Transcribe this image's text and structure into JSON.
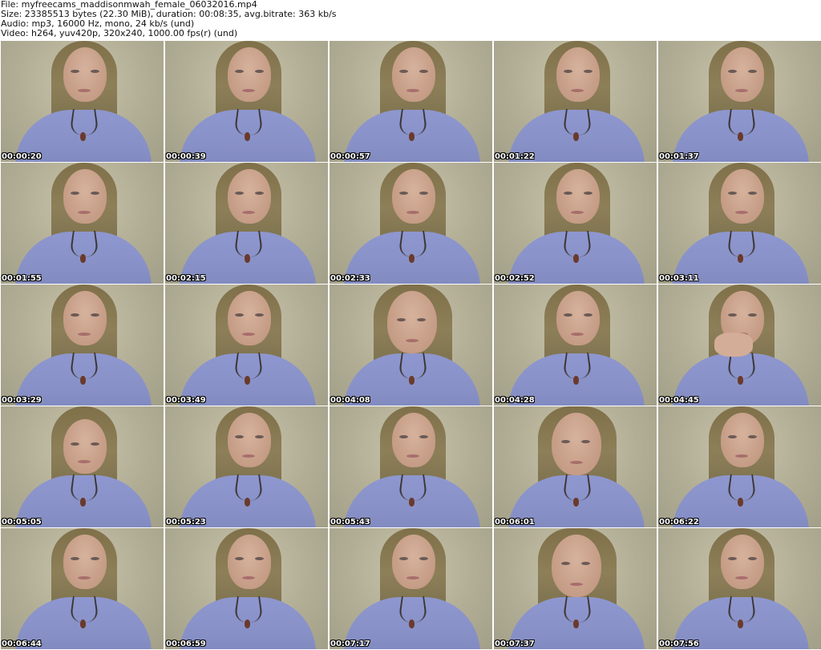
{
  "header": {
    "file_line": "File: myfreecams_maddisonmwah_female_06032016.mp4",
    "size_line": "Size: 23385513 bytes (22.30 MiB), duration: 00:08:35, avg.bitrate: 363 kb/s",
    "audio_line": "Audio: mp3, 16000 Hz, mono, 24 kb/s (und)",
    "video_line": "Video: h264, yuv420p, 320x240, 1000.00 fps(r) (und)"
  },
  "thumbnails": [
    {
      "timestamp": "00:00:20"
    },
    {
      "timestamp": "00:00:39"
    },
    {
      "timestamp": "00:00:57"
    },
    {
      "timestamp": "00:01:22"
    },
    {
      "timestamp": "00:01:37"
    },
    {
      "timestamp": "00:01:55"
    },
    {
      "timestamp": "00:02:15"
    },
    {
      "timestamp": "00:02:33"
    },
    {
      "timestamp": "00:02:52"
    },
    {
      "timestamp": "00:03:11"
    },
    {
      "timestamp": "00:03:29"
    },
    {
      "timestamp": "00:03:49"
    },
    {
      "timestamp": "00:04:08"
    },
    {
      "timestamp": "00:04:28"
    },
    {
      "timestamp": "00:04:45"
    },
    {
      "timestamp": "00:05:05"
    },
    {
      "timestamp": "00:05:23"
    },
    {
      "timestamp": "00:05:43"
    },
    {
      "timestamp": "00:06:01"
    },
    {
      "timestamp": "00:06:22"
    },
    {
      "timestamp": "00:06:44"
    },
    {
      "timestamp": "00:06:59"
    },
    {
      "timestamp": "00:07:17"
    },
    {
      "timestamp": "00:07:37"
    },
    {
      "timestamp": "00:07:56"
    }
  ]
}
